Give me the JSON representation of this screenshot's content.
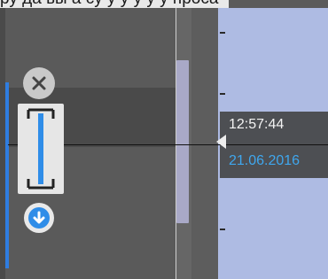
{
  "top_bar": {
    "text": "ру да ьы а су у у у у у проса"
  },
  "timeline": {
    "time": "12:57:44",
    "date": "21.06.2016"
  },
  "controls": {
    "close_icon": "close-icon",
    "range_icon": "range-bracket-icon",
    "download_icon": "arrow-down-icon"
  },
  "colors": {
    "accent": "#2f7de0",
    "date_text": "#3fa7ee",
    "right_panel": "#aebbe3"
  }
}
